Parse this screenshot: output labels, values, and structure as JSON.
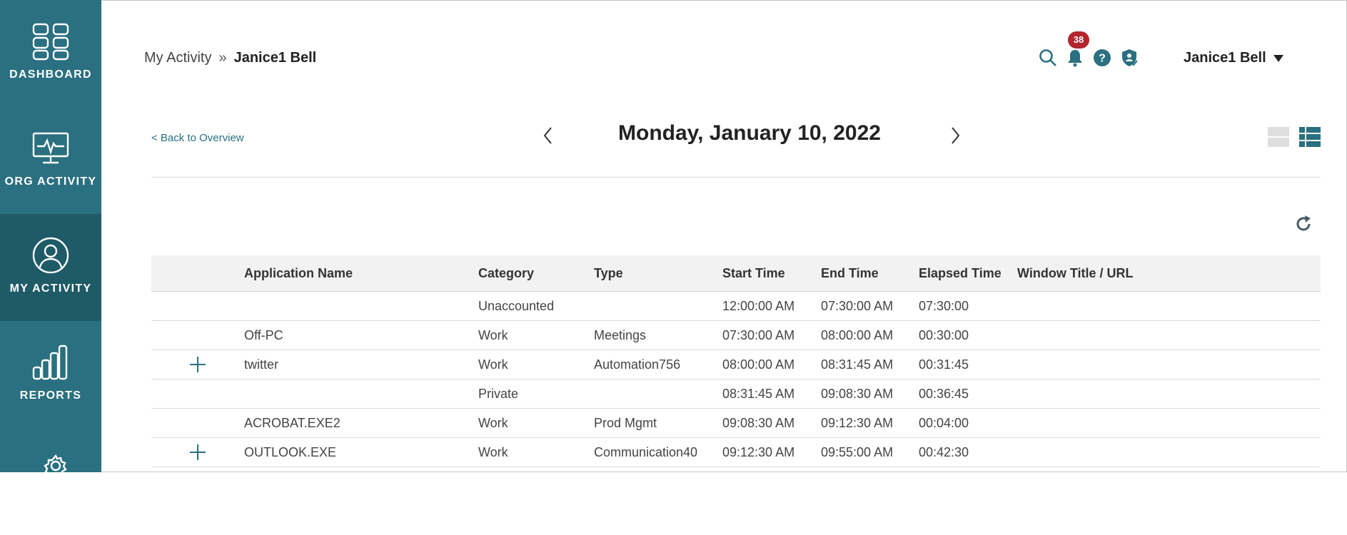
{
  "sidebar": {
    "items": [
      {
        "label": "DASHBOARD",
        "icon": "dashboard-icon"
      },
      {
        "label": "ORG ACTIVITY",
        "icon": "monitor-pulse-icon"
      },
      {
        "label": "MY ACTIVITY",
        "icon": "user-circle-icon",
        "active": true
      },
      {
        "label": "REPORTS",
        "icon": "bar-chart-icon"
      },
      {
        "label": "",
        "icon": "gear-icon"
      }
    ]
  },
  "header": {
    "breadcrumb_root": "My Activity",
    "breadcrumb_sep": "»",
    "breadcrumb_current": "Janice1 Bell",
    "notifications_count": "38",
    "user_name": "Janice1 Bell"
  },
  "datenav": {
    "back_label": "< Back to Overview",
    "date": "Monday, January 10, 2022"
  },
  "table": {
    "columns": [
      "Application Name",
      "Category",
      "Type",
      "Start Time",
      "End Time",
      "Elapsed Time",
      "Window Title / URL"
    ],
    "rows": [
      {
        "expandable": false,
        "app": "",
        "category": "Unaccounted",
        "type": "",
        "start": "12:00:00 AM",
        "end": "07:30:00 AM",
        "elapsed": "07:30:00",
        "window": ""
      },
      {
        "expandable": false,
        "app": "Off-PC",
        "category": "Work",
        "type": "Meetings",
        "start": "07:30:00 AM",
        "end": "08:00:00 AM",
        "elapsed": "00:30:00",
        "window": ""
      },
      {
        "expandable": true,
        "app": "twitter",
        "category": "Work",
        "type": "Automation756",
        "start": "08:00:00 AM",
        "end": "08:31:45 AM",
        "elapsed": "00:31:45",
        "window": ""
      },
      {
        "expandable": false,
        "app": "",
        "category": "Private",
        "type": "",
        "start": "08:31:45 AM",
        "end": "09:08:30 AM",
        "elapsed": "00:36:45",
        "window": ""
      },
      {
        "expandable": false,
        "app": "ACROBAT.EXE2",
        "category": "Work",
        "type": "Prod Mgmt",
        "start": "09:08:30 AM",
        "end": "09:12:30 AM",
        "elapsed": "00:04:00",
        "window": ""
      },
      {
        "expandable": true,
        "app": "OUTLOOK.EXE",
        "category": "Work",
        "type": "Communication40",
        "start": "09:12:30 AM",
        "end": "09:55:00 AM",
        "elapsed": "00:42:30",
        "window": ""
      }
    ]
  },
  "colors": {
    "sidebar": "#2a7080",
    "sidebar_active": "#1f5a67",
    "accent": "#2a7080",
    "badge": "#b3262d"
  }
}
